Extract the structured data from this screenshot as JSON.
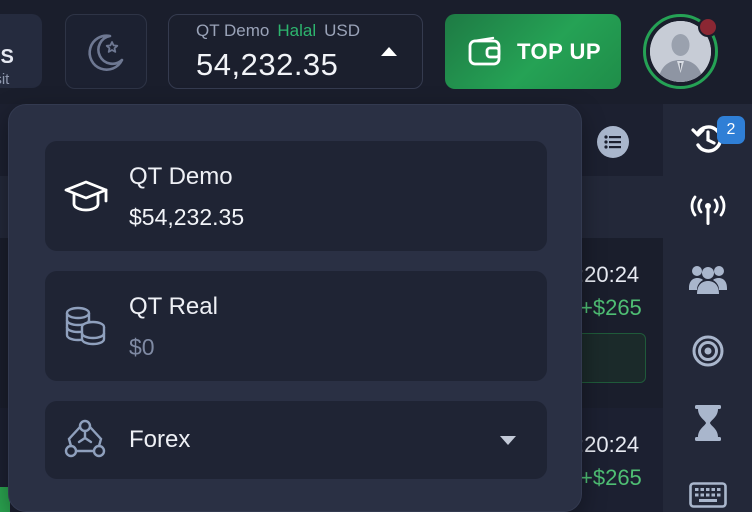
{
  "header": {
    "bonus_title": "US",
    "bonus_subtitle": "osit",
    "account_name": "QT Demo",
    "account_type": "Halal",
    "currency": "USD",
    "balance": "54,232.35",
    "topup_label": "TOP UP"
  },
  "dropdown": {
    "accounts": [
      {
        "name": "QT Demo",
        "balance": "$54,232.35",
        "icon": "graduation-cap-icon"
      },
      {
        "name": "QT Real",
        "balance": "$0",
        "icon": "coins-icon"
      }
    ],
    "forex_label": "Forex"
  },
  "background": {
    "trades": [
      {
        "time": ":20:24",
        "profit": "+$265"
      },
      {
        "time": ":20:24",
        "profit": "+$265"
      }
    ]
  },
  "sidebar": {
    "history_badge": "2",
    "items": [
      "history-icon",
      "signal-icon",
      "community-icon",
      "target-icon",
      "hourglass-icon",
      "keyboard-icon"
    ]
  },
  "colors": {
    "accent_green": "#25a255",
    "halal_green": "#2db56e",
    "badge_blue": "#2f7fd6",
    "profit_green": "#4fbf74"
  }
}
